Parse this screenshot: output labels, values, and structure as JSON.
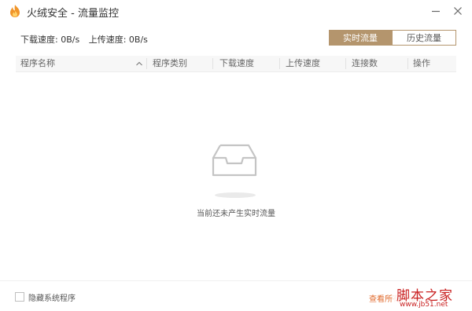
{
  "window": {
    "title": "火绒安全 - 流量监控",
    "logo_icon": "huorong-flame-logo",
    "minimize_icon": "minimize-icon",
    "close_icon": "close-icon"
  },
  "speed": {
    "download_label": "下载速度:",
    "download_value": "0B/s",
    "upload_label": "上传速度:",
    "upload_value": "0B/s"
  },
  "tabs": [
    {
      "label": "实时流量",
      "active": true
    },
    {
      "label": "历史流量",
      "active": false
    }
  ],
  "table": {
    "columns": [
      "程序名称",
      "程序类别",
      "下载速度",
      "上传速度",
      "连接数",
      "操作"
    ],
    "sort_icon": "chevron-up-icon",
    "rows": []
  },
  "empty_state": {
    "icon": "empty-tray-icon",
    "message": "当前还未产生实时流量"
  },
  "footer": {
    "checkbox_label": "隐藏系统程序",
    "checkbox_checked": false,
    "link_label": "查看所有连接"
  },
  "watermark": {
    "text": "脚本之家",
    "url": "www.jb51.net"
  },
  "colors": {
    "accent": "#b4956d",
    "link": "#e06a2c",
    "watermark": "#c92020"
  }
}
